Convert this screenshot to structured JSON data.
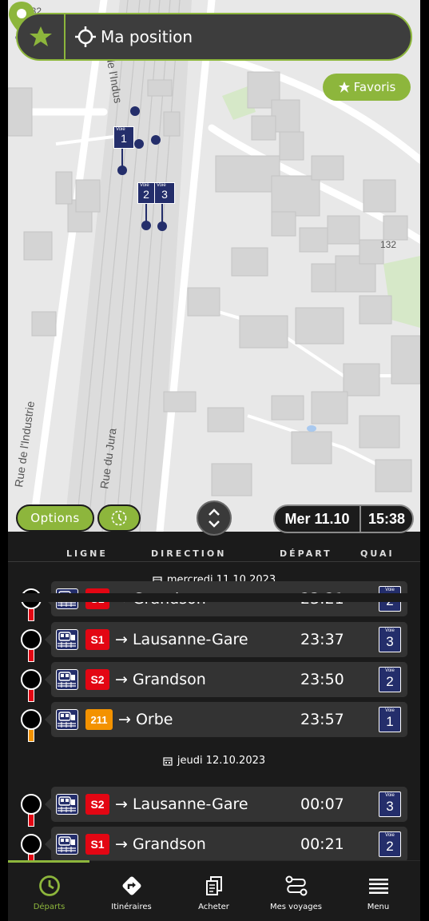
{
  "search": {
    "placeholder": "Ma position"
  },
  "favoris_label": "Favoris",
  "map": {
    "road_labels": [
      "Rue de l'Industrie",
      "Rue de l'Indus",
      "Rue du Jura",
      "Rue de l'Industrie"
    ],
    "route_numbers": [
      "132",
      "132"
    ],
    "voie_label": "Voie",
    "voies": [
      "1",
      "2",
      "3"
    ]
  },
  "controls": {
    "options_label": "Options",
    "date": "Mer 11.10",
    "time": "15:38"
  },
  "headers": {
    "ligne": "LIGNE",
    "direction": "DIRECTION",
    "depart": "DÉPART",
    "quai": "QUAI"
  },
  "days": [
    {
      "label": "mercredi 11.10.2023"
    },
    {
      "label": "jeudi 12.10.2023"
    }
  ],
  "departures": [
    {
      "line": "S1",
      "line_color": "#e30613",
      "direction": "→ Grandson",
      "time": "23:21",
      "voie": "2",
      "stem_color": "#e30613"
    },
    {
      "line": "S1",
      "line_color": "#e30613",
      "direction": "→ Lausanne-Gare",
      "time": "23:37",
      "voie": "3",
      "stem_color": "#e30613"
    },
    {
      "line": "S2",
      "line_color": "#e30613",
      "direction": "→ Grandson",
      "time": "23:50",
      "voie": "2",
      "stem_color": "#e30613"
    },
    {
      "line": "211",
      "line_color": "#f39200",
      "direction": "→ Orbe",
      "time": "23:57",
      "voie": "1",
      "stem_color": "#f39200"
    },
    {
      "line": "S2",
      "line_color": "#e30613",
      "direction": "→ Lausanne-Gare",
      "time": "00:07",
      "voie": "3",
      "stem_color": "#e30613"
    },
    {
      "line": "S1",
      "line_color": "#e30613",
      "direction": "→ Grandson",
      "time": "00:21",
      "voie": "2",
      "stem_color": "#e30613"
    }
  ],
  "nav": [
    {
      "label": "Départs",
      "icon": "clock-icon",
      "active": true
    },
    {
      "label": "Itinéraires",
      "icon": "directions-icon",
      "active": false
    },
    {
      "label": "Acheter",
      "icon": "tickets-icon",
      "active": false
    },
    {
      "label": "Mes voyages",
      "icon": "route-icon",
      "active": false
    },
    {
      "label": "Menu",
      "icon": "menu-icon",
      "active": false
    }
  ],
  "colors": {
    "accent": "#8db63c",
    "voie_blue": "#242e6b",
    "background": "#1b1b1b",
    "row_bg": "#333333"
  }
}
